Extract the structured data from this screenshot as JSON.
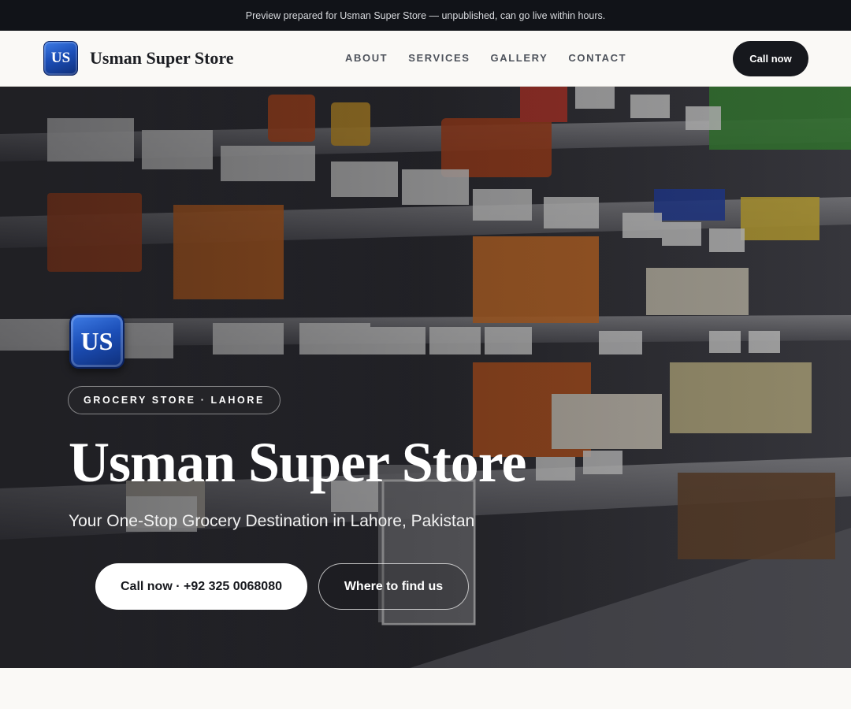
{
  "banner": {
    "text": "Preview prepared for Usman Super Store — unpublished, can go live within hours."
  },
  "header": {
    "logo_initials": "US",
    "brand_name": "Usman Super Store",
    "nav": [
      "ABOUT",
      "SERVICES",
      "GALLERY",
      "CONTACT"
    ],
    "call_label": "Call now"
  },
  "hero": {
    "badge_initials": "US",
    "category_pill": "GROCERY STORE · LAHORE",
    "title": "Usman Super Store",
    "tagline": "Your One-Stop Grocery Destination in Lahore, Pakistan",
    "primary_cta": "Call now · +92 325 0068080",
    "secondary_cta": "Where to find us",
    "background_image": "supermarket-shelves-photo"
  }
}
